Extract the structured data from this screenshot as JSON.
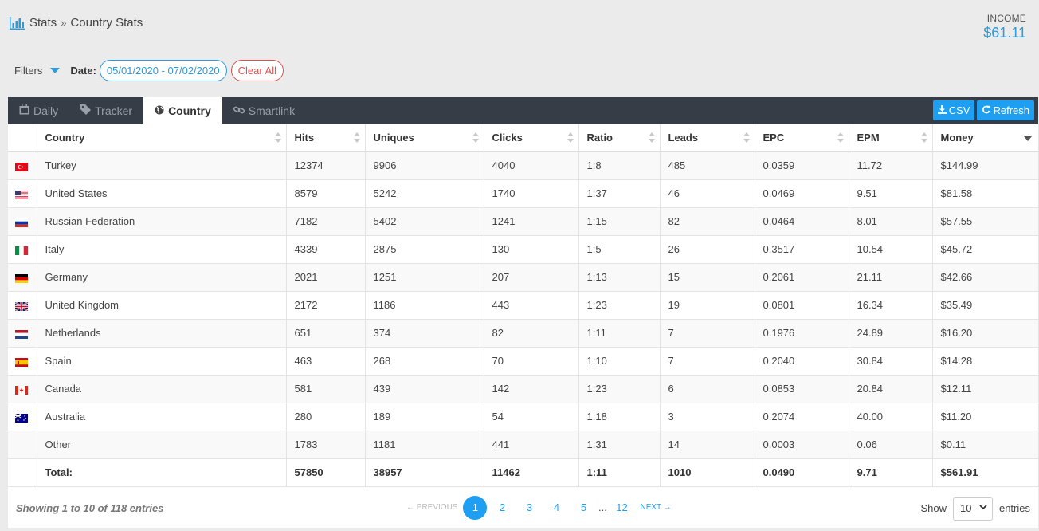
{
  "breadcrumb": {
    "root": "Stats",
    "separator": "»",
    "current": "Country Stats",
    "icon": "bar-chart-icon"
  },
  "income": {
    "label": "INCOME",
    "value": "$61.11"
  },
  "filters": {
    "label": "Filters",
    "date_label": "Date:",
    "date_range": "05/01/2020 - 07/02/2020",
    "clear_label": "Clear All"
  },
  "tabs": [
    {
      "label": "Daily",
      "icon": "calendar-icon"
    },
    {
      "label": "Tracker",
      "icon": "tag-icon"
    },
    {
      "label": "Country",
      "icon": "globe-icon",
      "active": true
    },
    {
      "label": "Smartlink",
      "icon": "link-icon"
    }
  ],
  "actions": {
    "csv": "CSV",
    "refresh": "Refresh"
  },
  "columns": [
    "Country",
    "Hits",
    "Uniques",
    "Clicks",
    "Ratio",
    "Leads",
    "EPC",
    "EPM",
    "Money"
  ],
  "rows": [
    {
      "flag": "TR",
      "country": "Turkey",
      "hits": "12374",
      "uniques": "9906",
      "clicks": "4040",
      "ratio": "1:8",
      "leads": "485",
      "epc": "0.0359",
      "epm": "11.72",
      "money": "$144.99"
    },
    {
      "flag": "US",
      "country": "United States",
      "hits": "8579",
      "uniques": "5242",
      "clicks": "1740",
      "ratio": "1:37",
      "leads": "46",
      "epc": "0.0469",
      "epm": "9.51",
      "money": "$81.58"
    },
    {
      "flag": "RU",
      "country": "Russian Federation",
      "hits": "7182",
      "uniques": "5402",
      "clicks": "1241",
      "ratio": "1:15",
      "leads": "82",
      "epc": "0.0464",
      "epm": "8.01",
      "money": "$57.55"
    },
    {
      "flag": "IT",
      "country": "Italy",
      "hits": "4339",
      "uniques": "2875",
      "clicks": "130",
      "ratio": "1:5",
      "leads": "26",
      "epc": "0.3517",
      "epm": "10.54",
      "money": "$45.72"
    },
    {
      "flag": "DE",
      "country": "Germany",
      "hits": "2021",
      "uniques": "1251",
      "clicks": "207",
      "ratio": "1:13",
      "leads": "15",
      "epc": "0.2061",
      "epm": "21.11",
      "money": "$42.66"
    },
    {
      "flag": "GB",
      "country": "United Kingdom",
      "hits": "2172",
      "uniques": "1186",
      "clicks": "443",
      "ratio": "1:23",
      "leads": "19",
      "epc": "0.0801",
      "epm": "16.34",
      "money": "$35.49"
    },
    {
      "flag": "NL",
      "country": "Netherlands",
      "hits": "651",
      "uniques": "374",
      "clicks": "82",
      "ratio": "1:11",
      "leads": "7",
      "epc": "0.1976",
      "epm": "24.89",
      "money": "$16.20"
    },
    {
      "flag": "ES",
      "country": "Spain",
      "hits": "463",
      "uniques": "268",
      "clicks": "70",
      "ratio": "1:10",
      "leads": "7",
      "epc": "0.2040",
      "epm": "30.84",
      "money": "$14.28"
    },
    {
      "flag": "CA",
      "country": "Canada",
      "hits": "581",
      "uniques": "439",
      "clicks": "142",
      "ratio": "1:23",
      "leads": "6",
      "epc": "0.0853",
      "epm": "20.84",
      "money": "$12.11"
    },
    {
      "flag": "AU",
      "country": "Australia",
      "hits": "280",
      "uniques": "189",
      "clicks": "54",
      "ratio": "1:18",
      "leads": "3",
      "epc": "0.2074",
      "epm": "40.00",
      "money": "$11.20"
    },
    {
      "flag": "",
      "country": "Other",
      "hits": "1783",
      "uniques": "1181",
      "clicks": "441",
      "ratio": "1:31",
      "leads": "14",
      "epc": "0.0003",
      "epm": "0.06",
      "money": "$0.11"
    }
  ],
  "total": {
    "label": "Total:",
    "hits": "57850",
    "uniques": "38957",
    "clicks": "11462",
    "ratio": "1:11",
    "leads": "1010",
    "epc": "0.0490",
    "epm": "9.71",
    "money": "$561.91"
  },
  "footer": {
    "showing": "Showing 1 to 10 of 118 entries",
    "prev": "← PREVIOUS",
    "pages": [
      "1",
      "2",
      "3",
      "4",
      "5"
    ],
    "ellipsis": "...",
    "last_page": "12",
    "next": "NEXT →",
    "show_label": "Show",
    "page_size": "10",
    "entries_label": "entries"
  }
}
